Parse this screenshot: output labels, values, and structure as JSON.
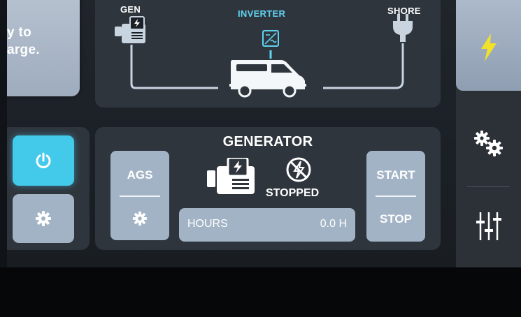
{
  "left_card": {
    "line1": "y to",
    "line2": "arge."
  },
  "diagram": {
    "gen_label": "GEN",
    "inverter_label": "INVERTER",
    "shore_label": "SHORE"
  },
  "generator": {
    "title": "GENERATOR",
    "status": "STOPPED",
    "ags_label": "AGS",
    "start_label": "START",
    "stop_label": "STOP",
    "hours_label": "HOURS",
    "hours_value": "0.0 H"
  },
  "colors": {
    "accent_cyan": "#43c9e9",
    "button_gray": "#a3b3c6",
    "lightning_yellow": "#f2e12a",
    "panel": "#2f353d"
  },
  "icons": [
    "power-icon",
    "gear-icon",
    "generator-icon",
    "inverter-icon",
    "plug-icon",
    "van-icon",
    "no-power-icon",
    "lightning-icon",
    "gears-icon",
    "sliders-icon"
  ]
}
